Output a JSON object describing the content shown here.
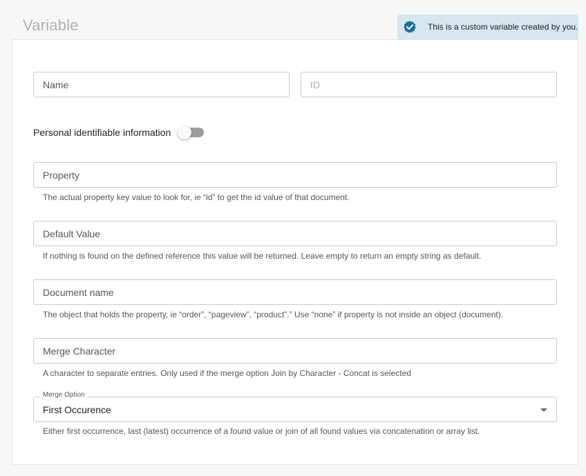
{
  "header": {
    "title": "Variable",
    "banner_text": "This is a custom variable created by you.",
    "banner_icon": "verified-badge-icon",
    "banner_color": "#d7e7f0",
    "badge_color": "#1a6ea0"
  },
  "form": {
    "name_placeholder": "Name",
    "id_placeholder": "ID",
    "pii_label": "Personal identifiable information",
    "pii_enabled": false,
    "property_placeholder": "Property",
    "property_help": "The actual property key value to look for, ie “id” to get the id value of that document.",
    "default_value_placeholder": "Default Value",
    "default_value_help": "If nothing is found on the defined reference this value will be returned. Leave empty to return an empty string as default.",
    "document_name_placeholder": "Document name",
    "document_name_help": "The object that holds the property, ie “order”, “pageview”, “product”.” Use “none” if property is not inside an object (document).",
    "merge_character_placeholder": "Merge Character",
    "merge_character_help": "A character to separate entries. Only used if the merge option Join by Character - Concat is selected",
    "merge_option_label": "Merge Option",
    "merge_option_value": "First Occurence",
    "merge_option_help": "Either first occurrence, last (latest) occurrence of a found value or join of all found values via concatenation or array list."
  }
}
